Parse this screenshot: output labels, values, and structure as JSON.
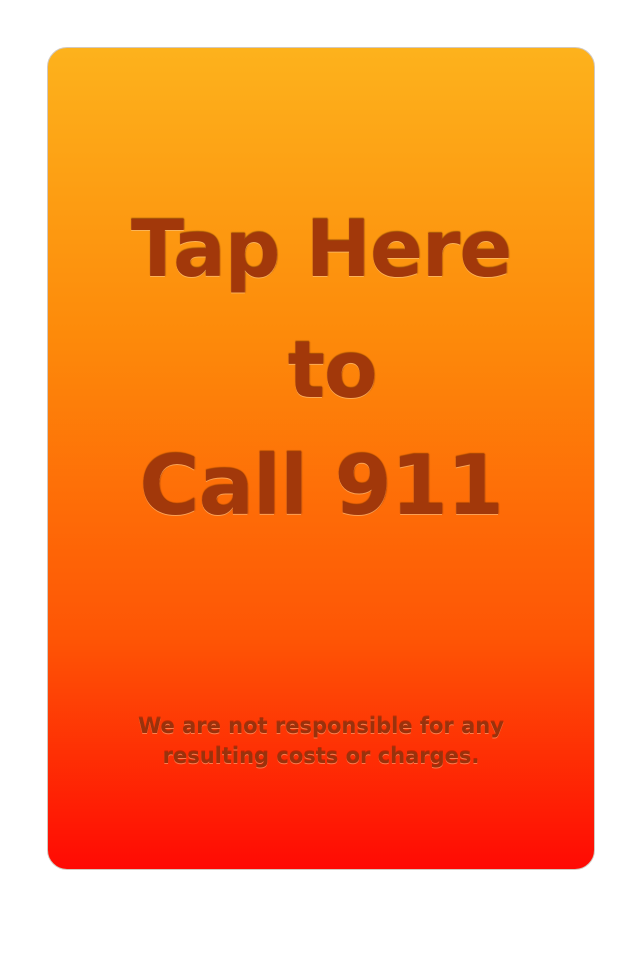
{
  "button": {
    "line1": "Tap Here",
    "line2": "to",
    "line3": "Call 911"
  },
  "disclaimer": {
    "line1": "We are not responsible for any",
    "line2": "resulting costs or charges."
  },
  "colors": {
    "gradient_top": "#fdb21c",
    "gradient_bottom": "#ff0a04",
    "text": "#a2380a"
  }
}
